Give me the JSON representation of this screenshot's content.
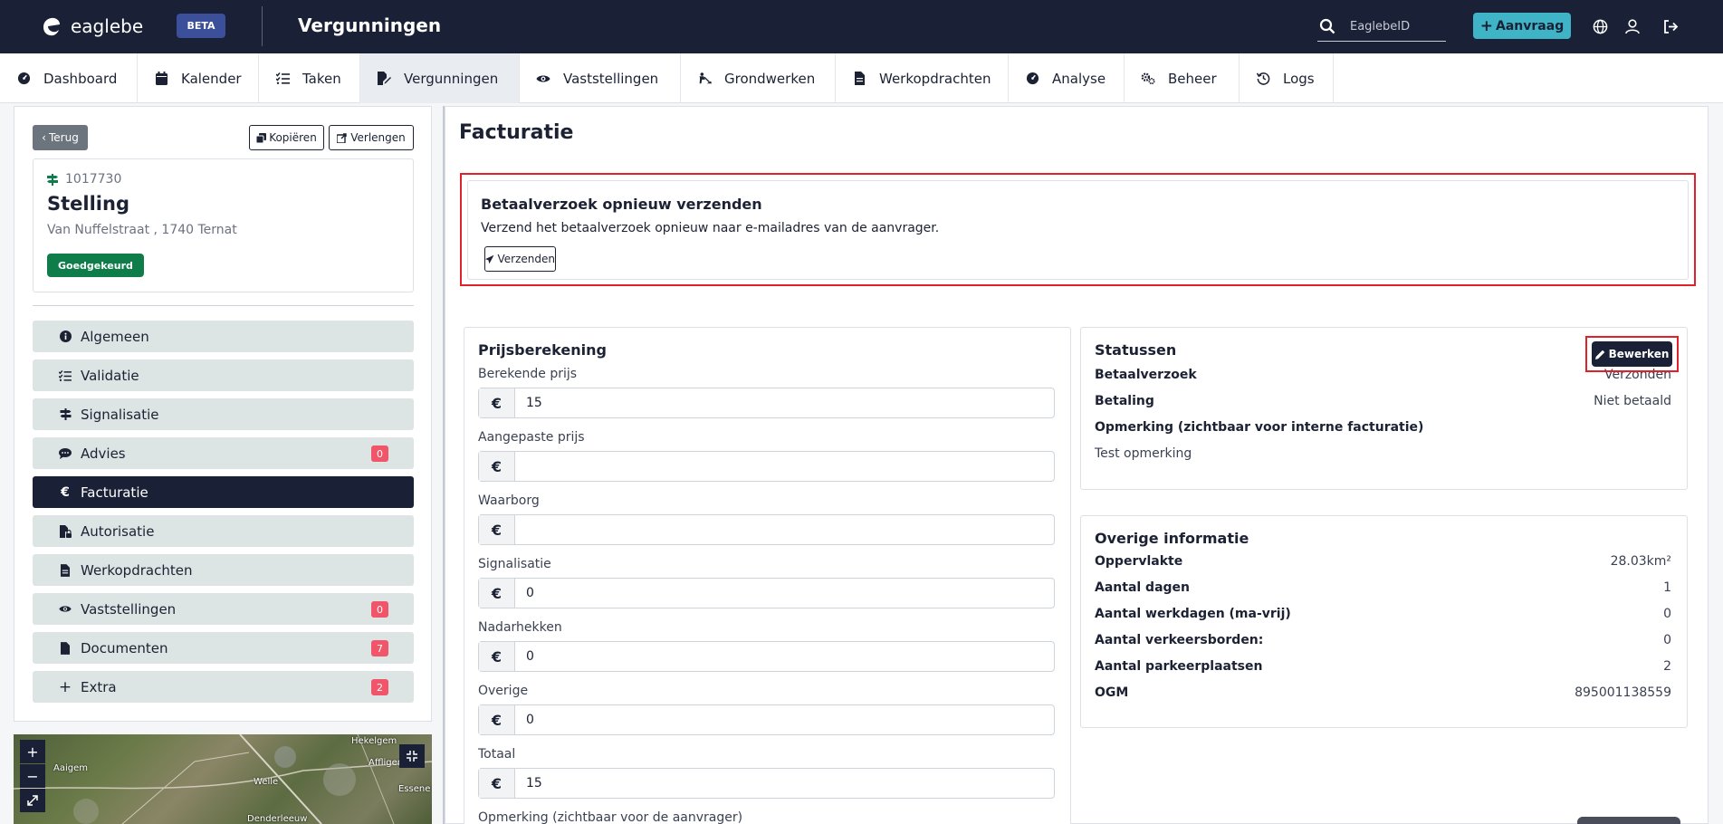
{
  "topbar": {
    "logo_text": "eaglebe",
    "beta": "BETA",
    "title": "Vergunningen",
    "search_placeholder": "EaglebeID",
    "aanvraag_label": "Aanvraag"
  },
  "nav": [
    {
      "label": "Dashboard",
      "icon": "dashboard-icon"
    },
    {
      "label": "Kalender",
      "icon": "calendar-icon"
    },
    {
      "label": "Taken",
      "icon": "tasks-icon"
    },
    {
      "label": "Vergunningen",
      "icon": "permit-icon",
      "active": true
    },
    {
      "label": "Vaststellingen",
      "icon": "eye-icon"
    },
    {
      "label": "Grondwerken",
      "icon": "digging-icon"
    },
    {
      "label": "Werkopdrachten",
      "icon": "document-icon"
    },
    {
      "label": "Analyse",
      "icon": "gauge-icon"
    },
    {
      "label": "Beheer",
      "icon": "gears-icon"
    },
    {
      "label": "Logs",
      "icon": "history-icon"
    }
  ],
  "left": {
    "back": "Terug",
    "copy": "Kopiëren",
    "extend": "Verlengen",
    "ref": "1017730",
    "title": "Stelling",
    "address": "Van Nuffelstraat , 1740 Ternat",
    "status": "Goedgekeurd",
    "menu": [
      {
        "label": "Algemeen",
        "icon": "info-icon",
        "count": ""
      },
      {
        "label": "Validatie",
        "icon": "list-check-icon",
        "count": ""
      },
      {
        "label": "Signalisatie",
        "icon": "signpost-icon",
        "count": ""
      },
      {
        "label": "Advies",
        "icon": "comment-icon",
        "count": "0"
      },
      {
        "label": "Facturatie",
        "icon": "euro-icon",
        "count": "",
        "active": true
      },
      {
        "label": "Autorisatie",
        "icon": "file-lock-icon",
        "count": ""
      },
      {
        "label": "Werkopdrachten",
        "icon": "document-icon",
        "count": ""
      },
      {
        "label": "Vaststellingen",
        "icon": "eye-icon",
        "count": "0"
      },
      {
        "label": "Documenten",
        "icon": "file-icon",
        "count": "7"
      },
      {
        "label": "Extra",
        "icon": "plus-icon",
        "count": "2"
      }
    ],
    "map_labels": [
      "Hekelgem",
      "Aaigem",
      "Affligem",
      "Welle",
      "Essene",
      "Denderleeuw"
    ]
  },
  "content": {
    "heading": "Facturatie",
    "resend": {
      "title": "Betaalverzoek opnieuw verzenden",
      "text": "Verzend het betaalverzoek opnieuw naar e-mailadres van de aanvrager.",
      "button": "Verzenden"
    },
    "pricing": {
      "title": "Prijsberekening",
      "currency": "€",
      "fields": [
        {
          "label": "Berekende prijs",
          "value": "15"
        },
        {
          "label": "Aangepaste prijs",
          "value": ""
        },
        {
          "label": "Waarborg",
          "value": ""
        },
        {
          "label": "Signalisatie",
          "value": "0"
        },
        {
          "label": "Nadarhekken",
          "value": "0"
        },
        {
          "label": "Overige",
          "value": "0"
        },
        {
          "label": "Totaal",
          "value": "15"
        }
      ],
      "remark_label": "Opmerking (zichtbaar voor de aanvrager)"
    },
    "statuses": {
      "title": "Statussen",
      "edit": "Bewerken",
      "rows": [
        {
          "k": "Betaalverzoek",
          "v": "Verzonden"
        },
        {
          "k": "Betaling",
          "v": "Niet betaald"
        }
      ],
      "remark_label": "Opmerking (zichtbaar voor interne facturatie)",
      "remark_value": "Test opmerking"
    },
    "other": {
      "title": "Overige informatie",
      "rows": [
        {
          "k": "Oppervlakte",
          "v": "28.03km²"
        },
        {
          "k": "Aantal dagen",
          "v": "1"
        },
        {
          "k": "Aantal werkdagen (ma-vrij)",
          "v": "0"
        },
        {
          "k": "Aantal verkeersborden:",
          "v": "0"
        },
        {
          "k": "Aantal parkeerplaatsen",
          "v": "2"
        },
        {
          "k": "OGM",
          "v": "895001138559"
        }
      ]
    }
  }
}
